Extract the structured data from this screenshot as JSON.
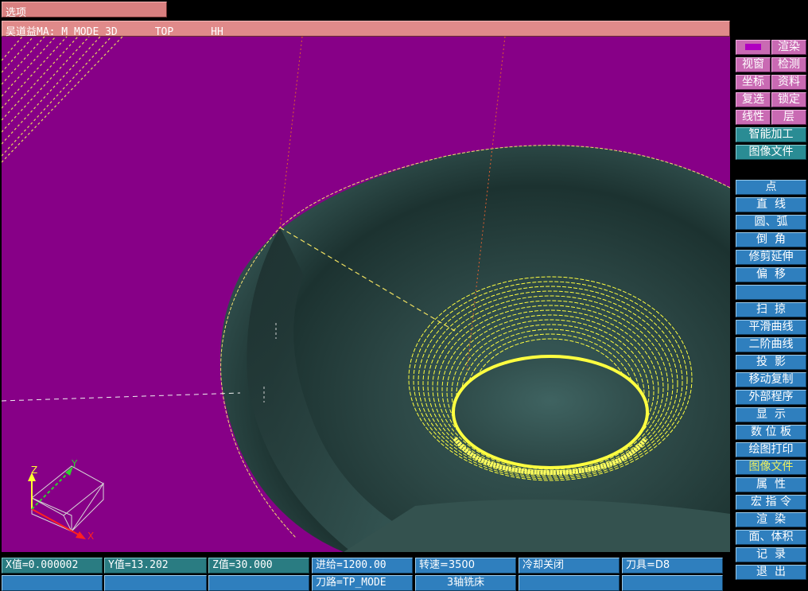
{
  "menu": {
    "options_label": "选项"
  },
  "status_line": {
    "text": "吴道益MA: M_MODE 3D      TOP      HH"
  },
  "colors": {
    "background": "#870087",
    "part": "#2f4d4b",
    "toolpath": "#ffff40",
    "guide": "#e06030"
  },
  "sidebar": {
    "top": [
      {
        "left": "",
        "right": "渲染",
        "swatch": true
      },
      {
        "left": "视窗",
        "right": "检测"
      },
      {
        "left": "坐标",
        "right": "资料"
      },
      {
        "left": "复选",
        "right": "锁定"
      },
      {
        "left": "线性",
        "right": "层"
      }
    ],
    "smart": [
      "智能加工",
      "图像文件"
    ],
    "commands": [
      {
        "label": "点",
        "active": false
      },
      {
        "label": "直  线",
        "active": false
      },
      {
        "label": "圆、弧",
        "active": false
      },
      {
        "label": "倒  角",
        "active": false
      },
      {
        "label": "修剪延伸",
        "active": false
      },
      {
        "label": "偏  移",
        "active": false
      },
      {
        "label": "",
        "active": false
      },
      {
        "label": "扫  掠",
        "active": false
      },
      {
        "label": "平滑曲线",
        "active": false
      },
      {
        "label": "二阶曲线",
        "active": false
      },
      {
        "label": "投  影",
        "active": false
      },
      {
        "label": "移动复制",
        "active": false
      },
      {
        "label": "外部程序",
        "active": false
      },
      {
        "label": "显  示",
        "active": false
      },
      {
        "label": "数 位 板",
        "active": false
      },
      {
        "label": "绘图打印",
        "active": false
      },
      {
        "label": "图像文件",
        "active": true
      },
      {
        "label": "属  性",
        "active": false
      },
      {
        "label": "宏 指 令",
        "active": false
      },
      {
        "label": "渲  染",
        "active": false
      },
      {
        "label": "面、体积",
        "active": false
      },
      {
        "label": "记  录",
        "active": false
      },
      {
        "label": "退  出",
        "active": false
      }
    ]
  },
  "status": {
    "x": "X值=0.000002",
    "y": "Y值=13.202",
    "z": "Z值=30.000",
    "feed": "进给=1200.00",
    "speed": "转速=3500",
    "coolant": "冷却关闭",
    "tool": "刀具=D8",
    "path": "刀路=TP_MODE",
    "machine": "3轴铣床"
  },
  "axes": {
    "x": "X",
    "y": "Y",
    "z": "Z"
  }
}
